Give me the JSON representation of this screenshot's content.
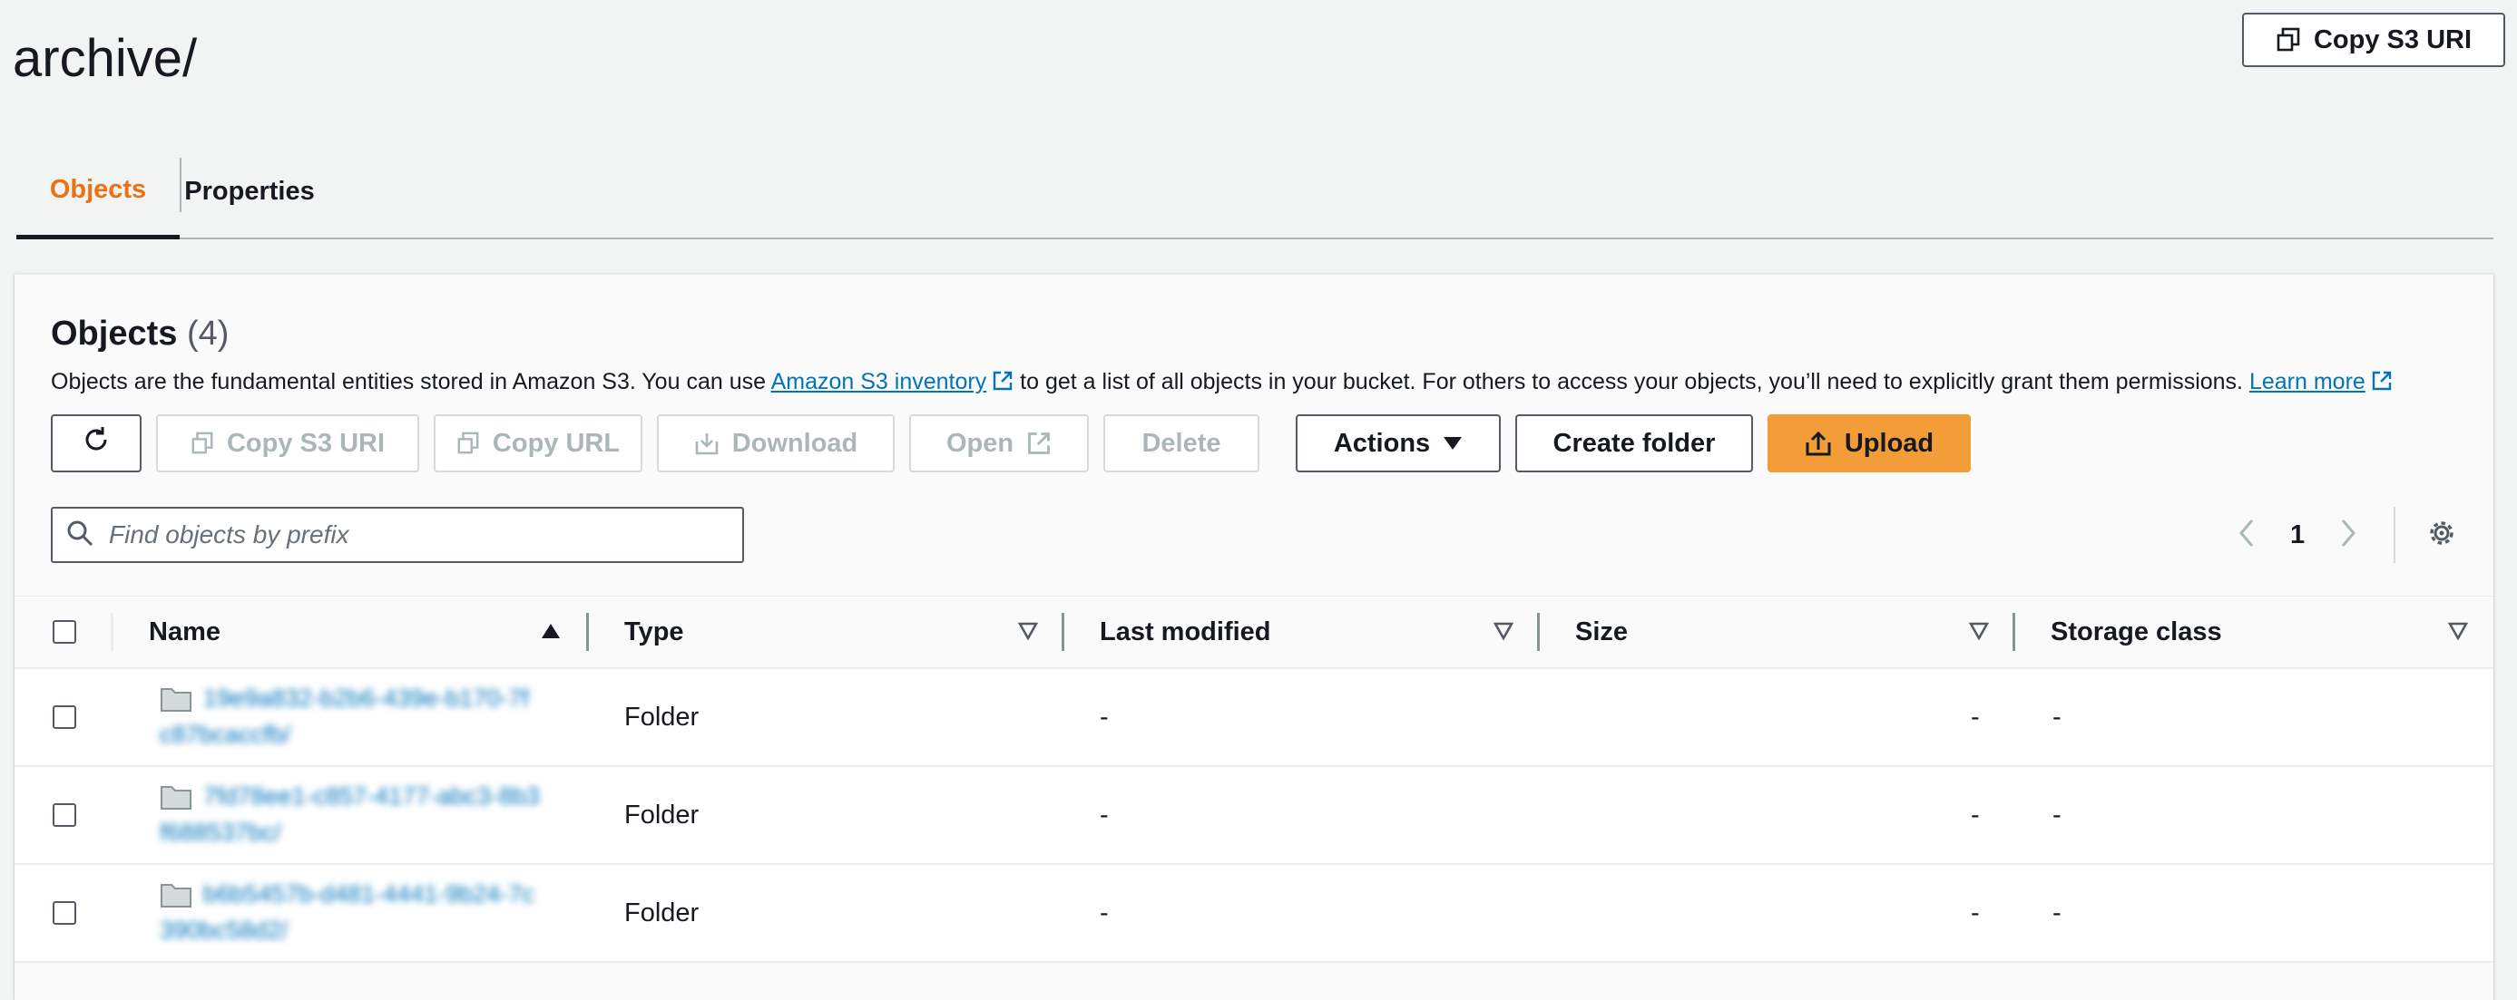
{
  "header": {
    "title": "archive/",
    "copy_s3_uri_label": "Copy S3 URI"
  },
  "tabs": [
    {
      "label": "Objects",
      "active": true
    },
    {
      "label": "Properties",
      "active": false
    }
  ],
  "panel": {
    "title": "Objects",
    "count": "(4)",
    "description": {
      "part1": "Objects are the fundamental entities stored in Amazon S3. You can use ",
      "inventory_link": "Amazon S3 inventory",
      "part2": " to get a list of all objects in your bucket. For others to access your objects, you’ll need to explicitly grant them permissions. ",
      "learn_more": "Learn more"
    },
    "toolbar": {
      "copy_s3_uri": "Copy S3 URI",
      "copy_url": "Copy URL",
      "download": "Download",
      "open": "Open",
      "delete": "Delete",
      "actions": "Actions",
      "create_folder": "Create folder",
      "upload": "Upload"
    },
    "search": {
      "placeholder": "Find objects by prefix"
    },
    "pagination": {
      "current_page": "1"
    }
  },
  "table": {
    "columns": {
      "name": "Name",
      "type": "Type",
      "last_modified": "Last modified",
      "size": "Size",
      "storage_class": "Storage class"
    },
    "rows": [
      {
        "name": "19e9a832-b2b6-439e-b170-7fc87bcaccfb/",
        "type": "Folder",
        "last_modified": "-",
        "size": "-",
        "storage_class": "-"
      },
      {
        "name": "7fd78ee1-c857-4177-abc3-8b3f688537bc/",
        "type": "Folder",
        "last_modified": "-",
        "size": "-",
        "storage_class": "-"
      },
      {
        "name": "b6b5457b-d481-4441-9b24-7c390bc58d2/",
        "type": "Folder",
        "last_modified": "-",
        "size": "-",
        "storage_class": "-"
      }
    ]
  },
  "colors": {
    "accent": "#ec7211",
    "primary_button": "#f29d38",
    "link": "#0073bb",
    "text": "#16191f"
  }
}
